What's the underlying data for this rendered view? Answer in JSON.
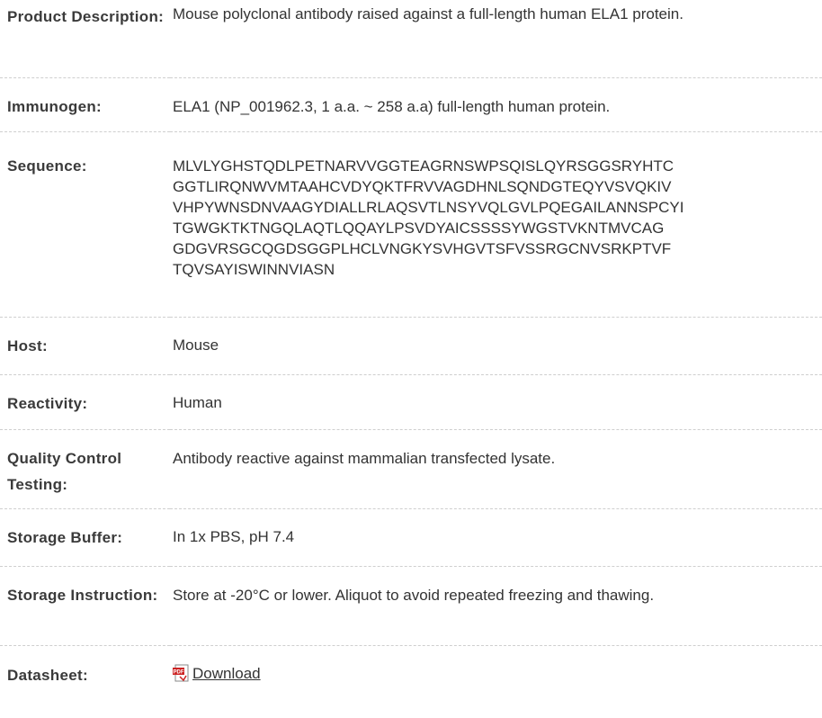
{
  "rows": [
    {
      "label": "Product Description:",
      "value": "Mouse polyclonal antibody raised against a full-length human ELA1 protein."
    },
    {
      "label": "Immunogen:",
      "value": "ELA1 (NP_001962.3, 1 a.a. ~ 258 a.a) full-length human protein."
    },
    {
      "label": "Sequence:",
      "value_lines": [
        "MLVLYGHSTQDLPETNARVVGGTEAGRNSWPSQISLQYRSGGSRYHTC",
        "GGTLIRQNWVMTAAHCVDYQKTFRVVAGDHNLSQNDGTEQYVSVQKIV",
        "VHPYWNSDNVAAGYDIALLRLAQSVTLNSYVQLGVLPQEGAILANNSPCYI",
        "TGWGKTKTNGQLAQTLQQAYLPSVDYAICSSSSYWGSTVKNTMVCAG",
        "GDGVRSGCQGDSGGPLHCLVNGKYSVHGVTSFVSSRGCNVSRKPTVF",
        "TQVSAYISWINNVIASN"
      ]
    },
    {
      "label": "Host:",
      "value": "Mouse"
    },
    {
      "label": "Reactivity:",
      "value": "Human"
    },
    {
      "label": "Quality Control Testing:",
      "value": "Antibody reactive against mammalian transfected lysate."
    },
    {
      "label": "Storage Buffer:",
      "value": "In 1x PBS, pH 7.4"
    },
    {
      "label": "Storage Instruction:",
      "value": "Store at -20°C or lower. Aliquot to avoid repeated freezing and thawing."
    },
    {
      "label": "Datasheet:",
      "link_text": "Download",
      "icon": "pdf-icon"
    }
  ]
}
